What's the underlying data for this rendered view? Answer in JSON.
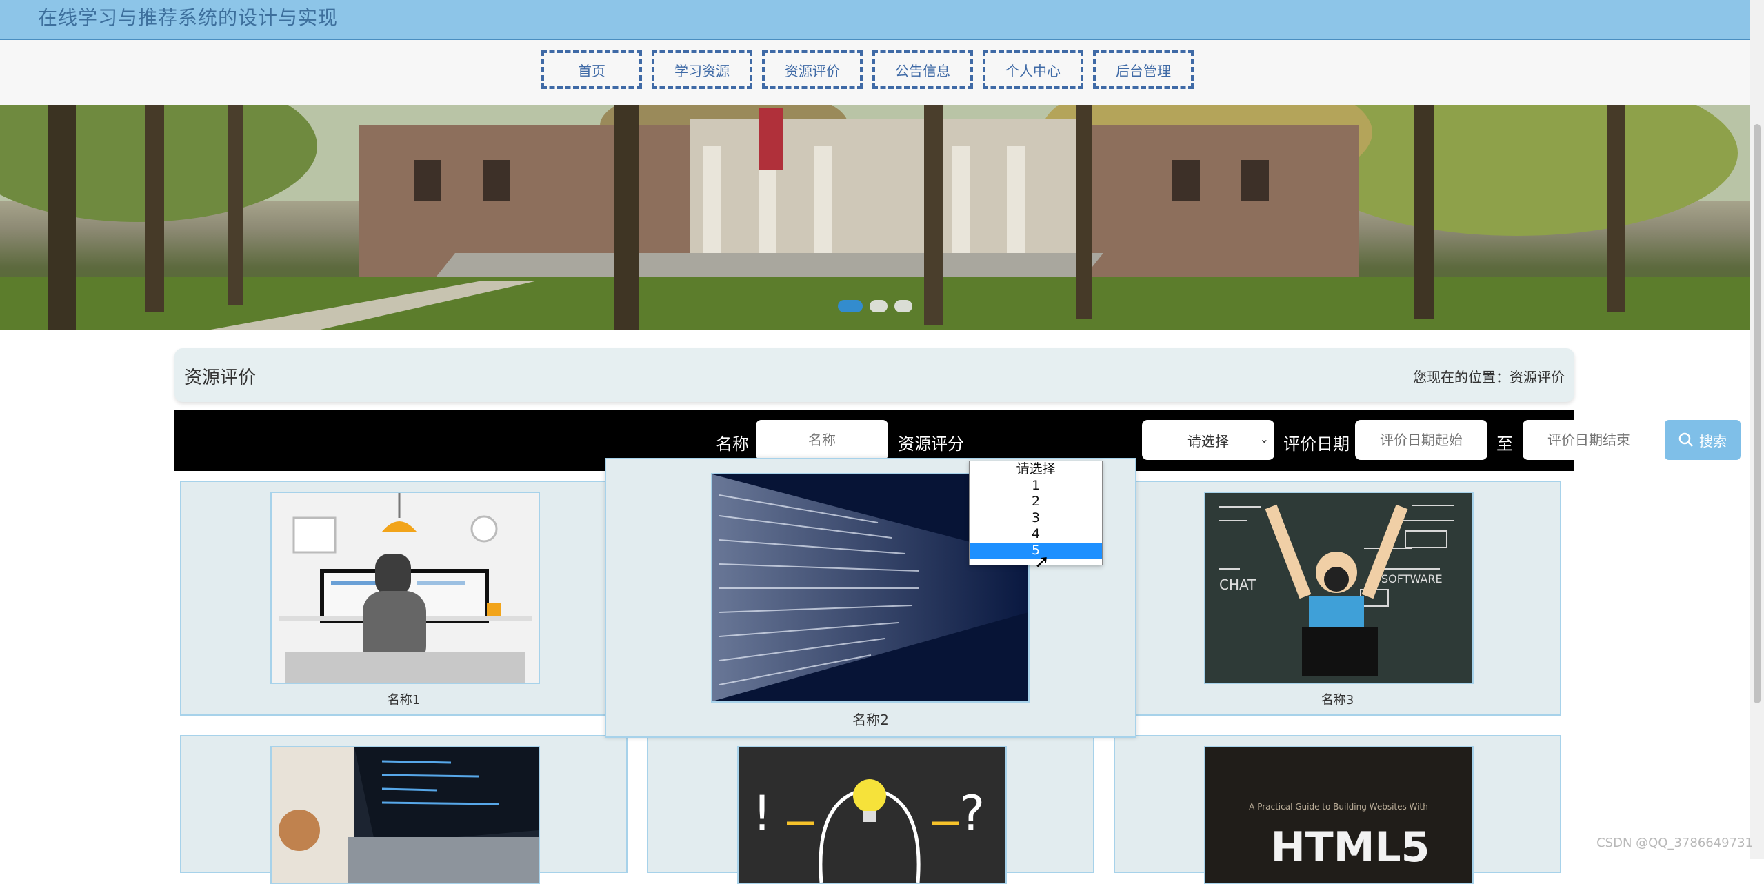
{
  "header": {
    "site_title": "在线学习与推荐系统的设计与实现"
  },
  "nav": [
    "首页",
    "学习资源",
    "资源评价",
    "公告信息",
    "个人中心",
    "后台管理"
  ],
  "page": {
    "title": "资源评价",
    "breadcrumb": "您现在的位置：资源评价"
  },
  "search": {
    "name_label": "名称",
    "name_placeholder": "名称",
    "rating_label": "资源评分",
    "rating_value": "请选择",
    "rating_options": [
      "请选择",
      "1",
      "2",
      "3",
      "4",
      "5"
    ],
    "rating_highlighted": "5",
    "date_label": "评价日期",
    "date_start_placeholder": "评价日期起始",
    "to_label": "至",
    "date_end_placeholder": "评价日期结束",
    "button_label": "搜索"
  },
  "cards": [
    {
      "caption": "名称1"
    },
    {
      "caption": "名称2"
    },
    {
      "caption": "名称3"
    },
    {
      "caption": ""
    },
    {
      "caption": ""
    },
    {
      "caption": ""
    }
  ],
  "card5_text": {
    "line1": "A Practical Guide to Building Websites With",
    "line2": "HTML5"
  },
  "carousel": {
    "slides": 3,
    "active": 0
  },
  "colors": {
    "header_bg": "#8dc5e8",
    "nav_border": "#3f6aa6",
    "search_bar_bg": "#000000",
    "accent": "#1e90ff",
    "card_bg": "#e2ecef"
  },
  "watermark": "CSDN @QQ_3786649731"
}
